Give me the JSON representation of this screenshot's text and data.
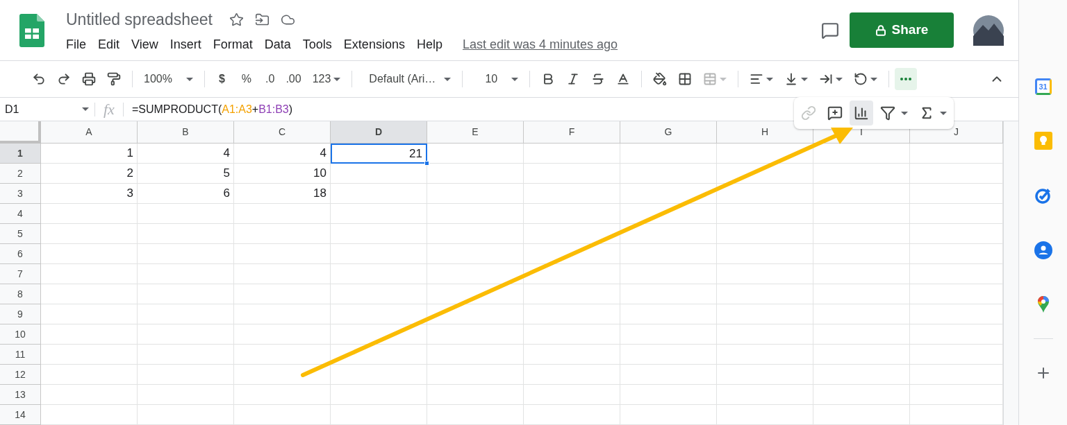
{
  "document": {
    "title": "Untitled spreadsheet",
    "last_edit": "Last edit was 4 minutes ago"
  },
  "menu": [
    "File",
    "Edit",
    "View",
    "Insert",
    "Format",
    "Data",
    "Tools",
    "Extensions",
    "Help"
  ],
  "share_button": "Share",
  "toolbar": {
    "zoom": "100%",
    "currency": "$",
    "percent": "%",
    "decrease_decimal": ".0",
    "increase_decimal": ".00",
    "number_format": "123",
    "font": "Default (Ari…",
    "font_size": "10",
    "merge_disabled": true,
    "more_selected": true
  },
  "popup": [
    {
      "kind": "link",
      "disabled": true,
      "selected": false
    },
    {
      "kind": "comment",
      "disabled": false,
      "selected": false
    },
    {
      "kind": "chart",
      "disabled": false,
      "selected": true
    },
    {
      "kind": "filter",
      "disabled": false,
      "selected": false
    },
    {
      "kind": "sum",
      "disabled": false,
      "selected": false
    }
  ],
  "formula_bar": {
    "name_box": "D1",
    "fx": "fx",
    "formula": [
      {
        "text": "=SUMPRODUCT(",
        "color": "#202124"
      },
      {
        "text": "A1:A3",
        "color": "#f4a100"
      },
      {
        "text": "+",
        "color": "#202124"
      },
      {
        "text": "B1:B3",
        "color": "#8e3fb5"
      },
      {
        "text": ")",
        "color": "#202124"
      }
    ]
  },
  "columns": [
    {
      "label": "A",
      "selected": false
    },
    {
      "label": "B",
      "selected": false
    },
    {
      "label": "C",
      "selected": false
    },
    {
      "label": "D",
      "selected": true
    },
    {
      "label": "E",
      "selected": false
    },
    {
      "label": "F",
      "selected": false
    },
    {
      "label": "G",
      "selected": false
    },
    {
      "label": "H",
      "selected": false
    },
    {
      "label": "I",
      "selected": false
    },
    {
      "label": "J",
      "selected": false
    }
  ],
  "rows": [
    {
      "label": "1",
      "selected": true,
      "cells": [
        {
          "value": "1",
          "selected": false
        },
        {
          "value": "4",
          "selected": false
        },
        {
          "value": "4",
          "selected": false
        },
        {
          "value": "21",
          "selected": true
        }
      ]
    },
    {
      "label": "2",
      "selected": false,
      "cells": [
        {
          "value": "2",
          "selected": false
        },
        {
          "value": "5",
          "selected": false
        },
        {
          "value": "10",
          "selected": false
        }
      ]
    },
    {
      "label": "3",
      "selected": false,
      "cells": [
        {
          "value": "3",
          "selected": false
        },
        {
          "value": "6",
          "selected": false
        },
        {
          "value": "18",
          "selected": false
        }
      ]
    },
    {
      "label": "4",
      "selected": false
    },
    {
      "label": "5",
      "selected": false
    },
    {
      "label": "6",
      "selected": false
    },
    {
      "label": "7",
      "selected": false
    },
    {
      "label": "8",
      "selected": false
    },
    {
      "label": "9",
      "selected": false
    },
    {
      "label": "10",
      "selected": false
    },
    {
      "label": "11",
      "selected": false
    },
    {
      "label": "12",
      "selected": false
    },
    {
      "label": "13",
      "selected": false
    },
    {
      "label": "14",
      "selected": false
    }
  ],
  "side_panel": [
    {
      "kind": "calendar",
      "label": "31"
    },
    {
      "kind": "keep"
    },
    {
      "kind": "tasks"
    },
    {
      "kind": "contacts"
    },
    {
      "kind": "maps"
    }
  ]
}
